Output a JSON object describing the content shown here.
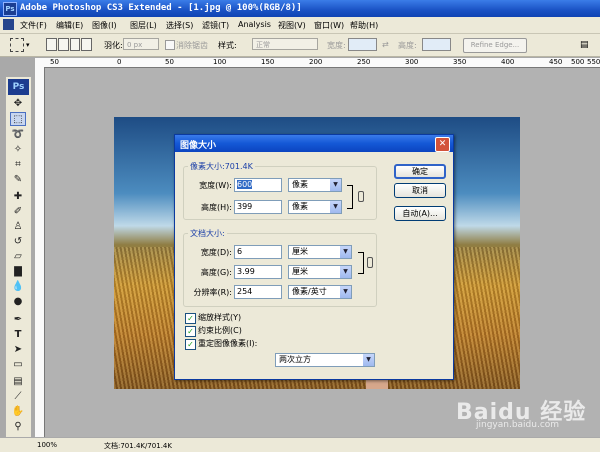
{
  "window": {
    "title": "Adobe Photoshop CS3 Extended - [1.jpg @ 100%(RGB/8)]",
    "app_icon": "Ps"
  },
  "menu": [
    "文件(F)",
    "编辑(E)",
    "图像(I)",
    "图层(L)",
    "选择(S)",
    "滤镜(T)",
    "Analysis",
    "视图(V)",
    "窗口(W)",
    "帮助(H)"
  ],
  "options_bar": {
    "feather_label": "羽化:",
    "feather_value": "0 px",
    "antialias_label": "消除锯齿",
    "style_label": "样式:",
    "style_value": "正常",
    "width_label": "宽度:",
    "height_label": "高度:",
    "refine_edge": "Refine Edge..."
  },
  "ruler_ticks": [
    "50",
    "0",
    "50",
    "100",
    "150",
    "200",
    "250",
    "300",
    "350",
    "400",
    "450",
    "500",
    "550"
  ],
  "toolbox": {
    "logo": "Ps"
  },
  "status_bar": {
    "zoom": "100%",
    "doc_info": "文档:701.4K/701.4K"
  },
  "watermark": {
    "brand": "Baidu 经验",
    "url": "jingyan.baidu.com"
  },
  "dialog": {
    "title": "图像大小",
    "close_label": "✕",
    "pixel_group": {
      "legend": "像素大小:701.4K",
      "width_label": "宽度(W):",
      "width_value": "600",
      "width_unit": "像素",
      "height_label": "高度(H):",
      "height_value": "399",
      "height_unit": "像素"
    },
    "doc_group": {
      "legend": "文档大小:",
      "width_label": "宽度(D):",
      "width_value": "6",
      "width_unit": "厘米",
      "height_label": "高度(G):",
      "height_value": "3.99",
      "height_unit": "厘米",
      "res_label": "分辨率(R):",
      "res_value": "254",
      "res_unit": "像素/英寸"
    },
    "buttons": {
      "ok": "确定",
      "cancel": "取消",
      "auto": "自动(A)..."
    },
    "checkboxes": {
      "scale_styles": "缩放样式(Y)",
      "constrain": "约束比例(C)",
      "resample": "重定图像像素(I):"
    },
    "resample_method": "两次立方"
  }
}
